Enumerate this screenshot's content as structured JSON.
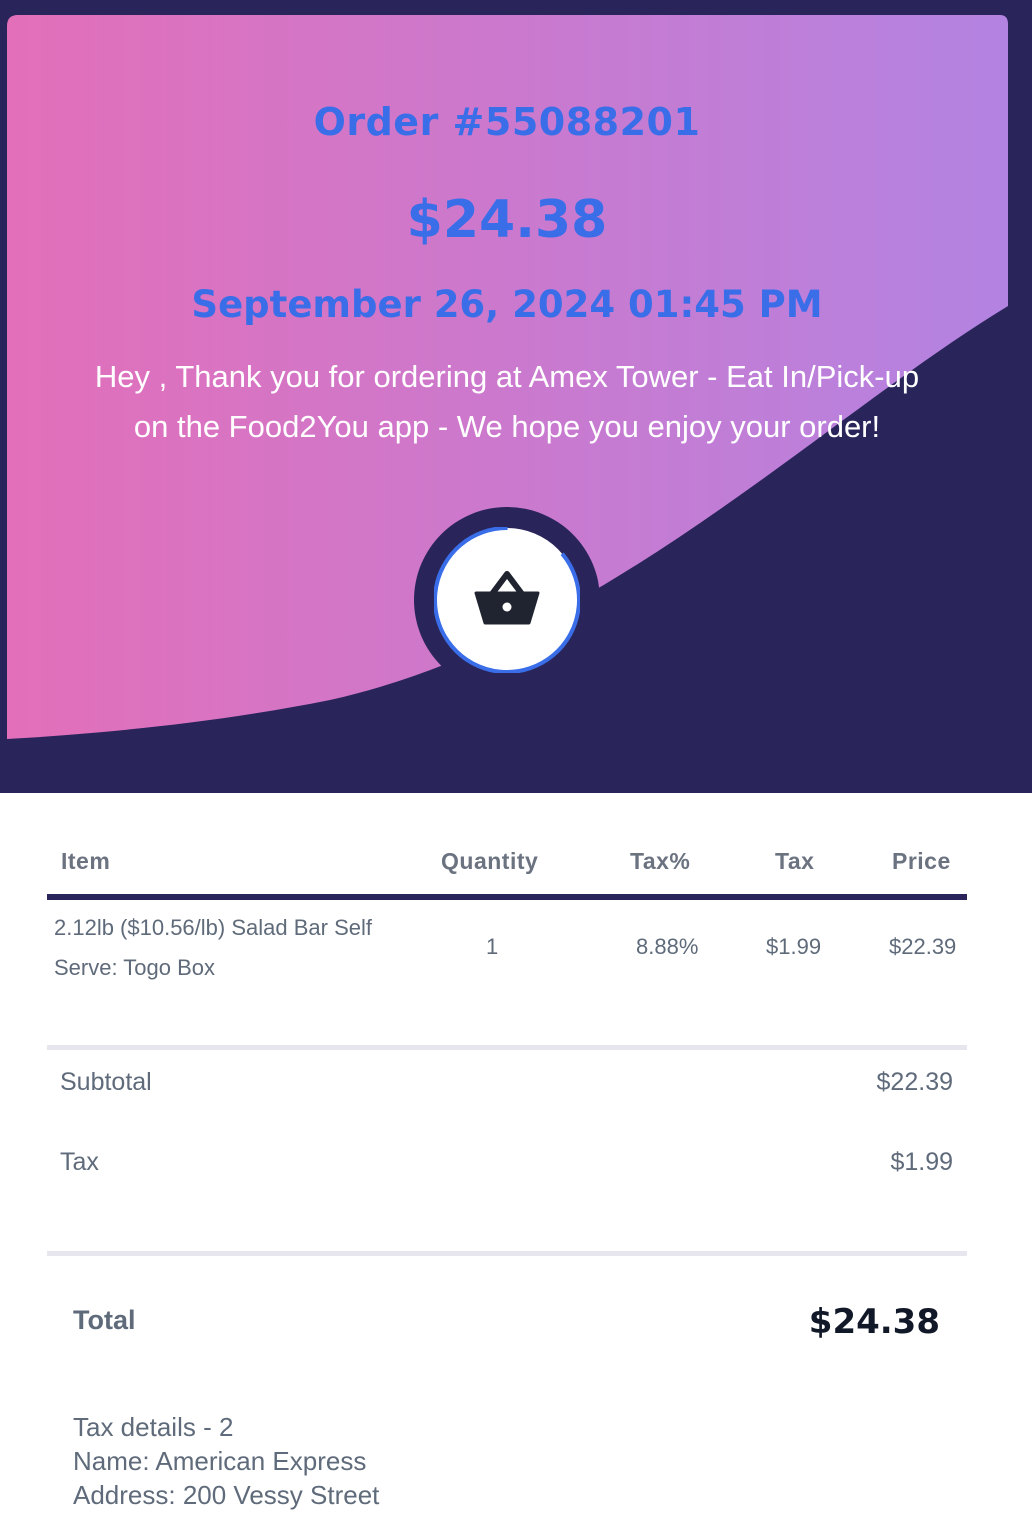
{
  "header": {
    "order_title": "Order #55088201",
    "amount": "$24.38",
    "date": "September 26, 2024 01:45 PM",
    "thanks_line1": "Hey , Thank you for ordering at Amex Tower - Eat In/Pick-up",
    "thanks_line2": "on the Food2You app - We hope you enjoy your order!",
    "icon": "basket-icon"
  },
  "colors": {
    "navy": "#29255a",
    "gradient_start": "#e36fb9",
    "gradient_end": "#b383e2",
    "accent_blue": "#3a6ee8"
  },
  "table": {
    "headers": [
      "Item",
      "Quantity",
      "Tax%",
      "Tax",
      "Price"
    ],
    "rows": [
      {
        "item_line1": "2.12lb ($10.56/lb) Salad Bar Self",
        "item_line2": "Serve: Togo Box",
        "quantity": "1",
        "tax_pct": "8.88%",
        "tax": "$1.99",
        "price": "$22.39"
      }
    ]
  },
  "summary": {
    "subtotal_label": "Subtotal",
    "subtotal_value": "$22.39",
    "tax_label": "Tax",
    "tax_value": "$1.99",
    "total_label": "Total",
    "total_value": "$24.38"
  },
  "tax_details": {
    "line1": "Tax details - 2",
    "line2": "Name: American Express",
    "line3": "Address: 200 Vessy Street"
  }
}
